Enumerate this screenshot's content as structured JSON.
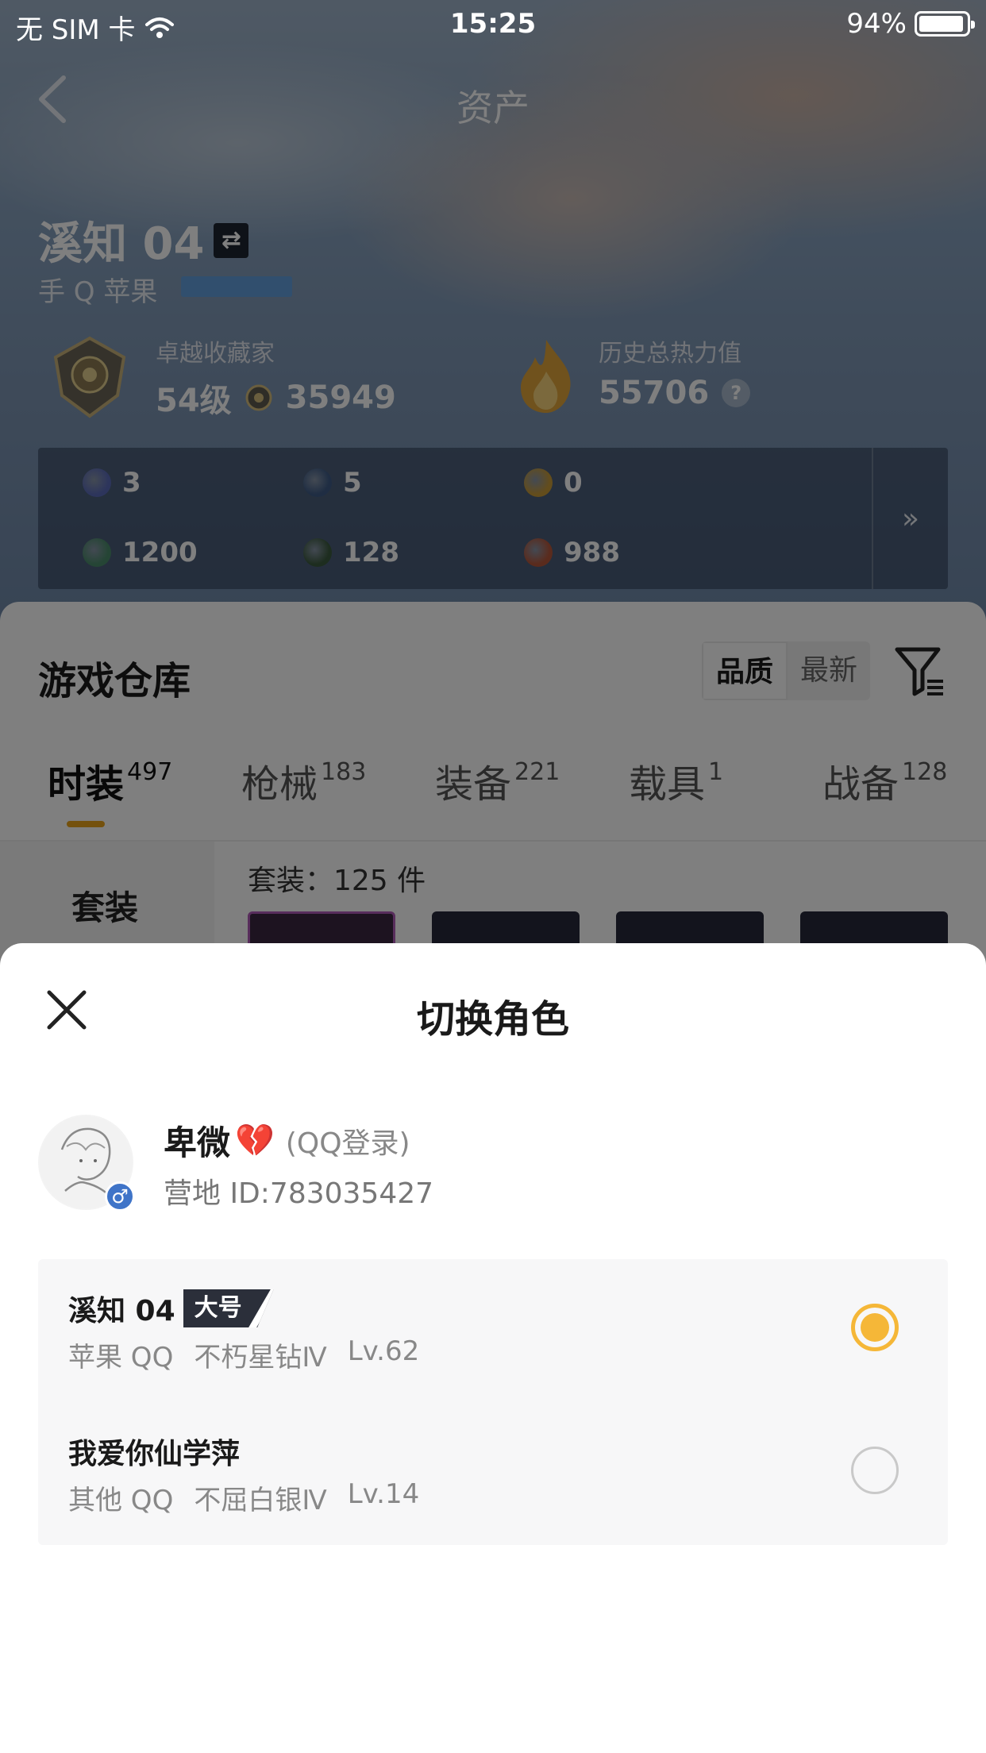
{
  "status_bar": {
    "carrier": "无 SIM 卡",
    "time": "15:25",
    "battery": "94%",
    "battery_level": 0.94
  },
  "nav": {
    "title": "资产"
  },
  "profile": {
    "role_name": "溪知 04",
    "swap_symbol": "⇄",
    "platform": "手 Q 苹果"
  },
  "collector": {
    "label": "卓越收藏家",
    "level": "54级",
    "points": "35949"
  },
  "heat": {
    "label": "历史总热力值",
    "value": "55706",
    "help": "?"
  },
  "resources": {
    "items": [
      {
        "value": "3",
        "color": "#5b6bb8"
      },
      {
        "value": "5",
        "color": "#3e5b86"
      },
      {
        "value": "0",
        "color": "#c79a38"
      },
      {
        "value": "1200",
        "color": "#4a8a6a"
      },
      {
        "value": "128",
        "color": "#3b5a3f"
      },
      {
        "value": "988",
        "color": "#b5563a"
      }
    ],
    "more": "»"
  },
  "warehouse": {
    "title": "游戏仓库",
    "sort_options": [
      "品质",
      "最新"
    ],
    "tabs": [
      {
        "label": "时装",
        "count": "497"
      },
      {
        "label": "枪械",
        "count": "183"
      },
      {
        "label": "装备",
        "count": "221"
      },
      {
        "label": "载具",
        "count": "1"
      },
      {
        "label": "战备",
        "count": "128"
      }
    ],
    "side_item": "套装",
    "count_text": "套装：125 件"
  },
  "modal": {
    "title": "切换角色",
    "user": {
      "name": "卑微",
      "heart": "💔",
      "login": "(QQ登录)",
      "camp_id": "营地 ID:783035427",
      "gender_symbol": "♂"
    },
    "roles": [
      {
        "name": "溪知 04",
        "tag": "大号",
        "platform": "苹果 QQ",
        "rank": "不朽星钻Ⅳ",
        "level": "Lv.62",
        "selected": true
      },
      {
        "name": "我爱你仙学萍",
        "tag": "",
        "platform": "其他 QQ",
        "rank": "不屈白银Ⅳ",
        "level": "Lv.14",
        "selected": false
      }
    ]
  },
  "colors": {
    "accent": "#f5b738",
    "tab_underline": "#e8a21a",
    "gender_badge": "#3f74c8"
  }
}
